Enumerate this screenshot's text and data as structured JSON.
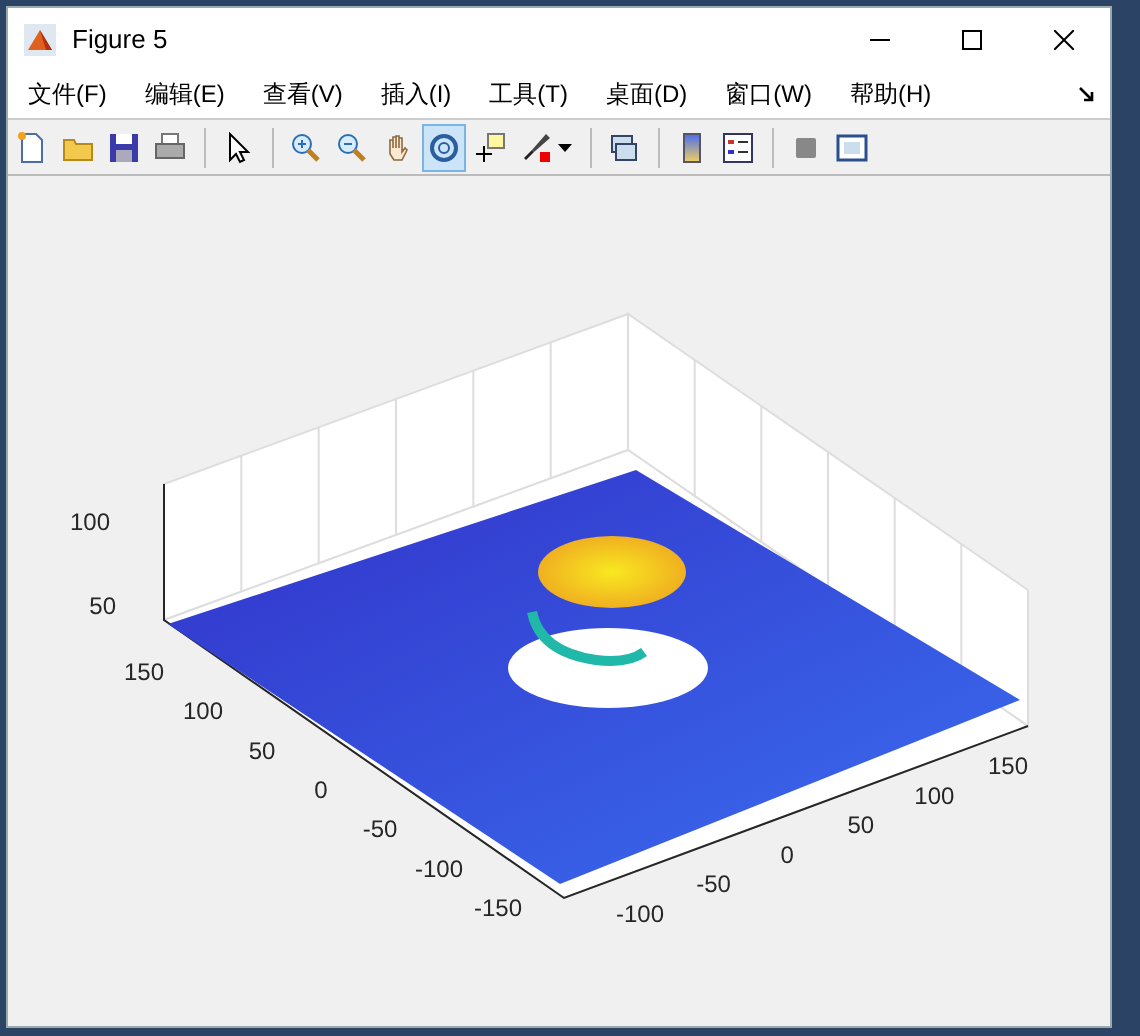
{
  "window": {
    "title": "Figure 5"
  },
  "menu": [
    {
      "label": "文件(F)"
    },
    {
      "label": "编辑(E)"
    },
    {
      "label": "查看(V)"
    },
    {
      "label": "插入(I)"
    },
    {
      "label": "工具(T)"
    },
    {
      "label": "桌面(D)"
    },
    {
      "label": "窗口(W)"
    },
    {
      "label": "帮助(H)"
    }
  ],
  "toolbar": [
    {
      "kind": "button",
      "selected": false
    },
    {
      "kind": "button",
      "selected": false
    },
    {
      "kind": "button",
      "selected": false
    },
    {
      "kind": "button",
      "selected": false
    },
    {
      "kind": "separator"
    },
    {
      "kind": "button",
      "selected": false
    },
    {
      "kind": "separator"
    },
    {
      "kind": "button",
      "selected": false
    },
    {
      "kind": "button",
      "selected": false
    },
    {
      "kind": "button",
      "selected": false
    },
    {
      "kind": "button",
      "selected": true
    },
    {
      "kind": "button",
      "selected": false
    },
    {
      "kind": "dropdown",
      "selected": false
    },
    {
      "kind": "separator"
    },
    {
      "kind": "button",
      "selected": false
    },
    {
      "kind": "separator"
    },
    {
      "kind": "button",
      "selected": false
    },
    {
      "kind": "button",
      "selected": false
    },
    {
      "kind": "separator"
    },
    {
      "kind": "button",
      "selected": false
    },
    {
      "kind": "button",
      "selected": false
    }
  ],
  "axes": {
    "z_ticks": [
      "100",
      "50"
    ],
    "y_ticks": [
      "150",
      "100",
      "50",
      "0",
      "-50",
      "-100",
      "-150"
    ],
    "x_ticks": [
      "-100",
      "-50",
      "0",
      "50",
      "100",
      "150"
    ]
  }
}
